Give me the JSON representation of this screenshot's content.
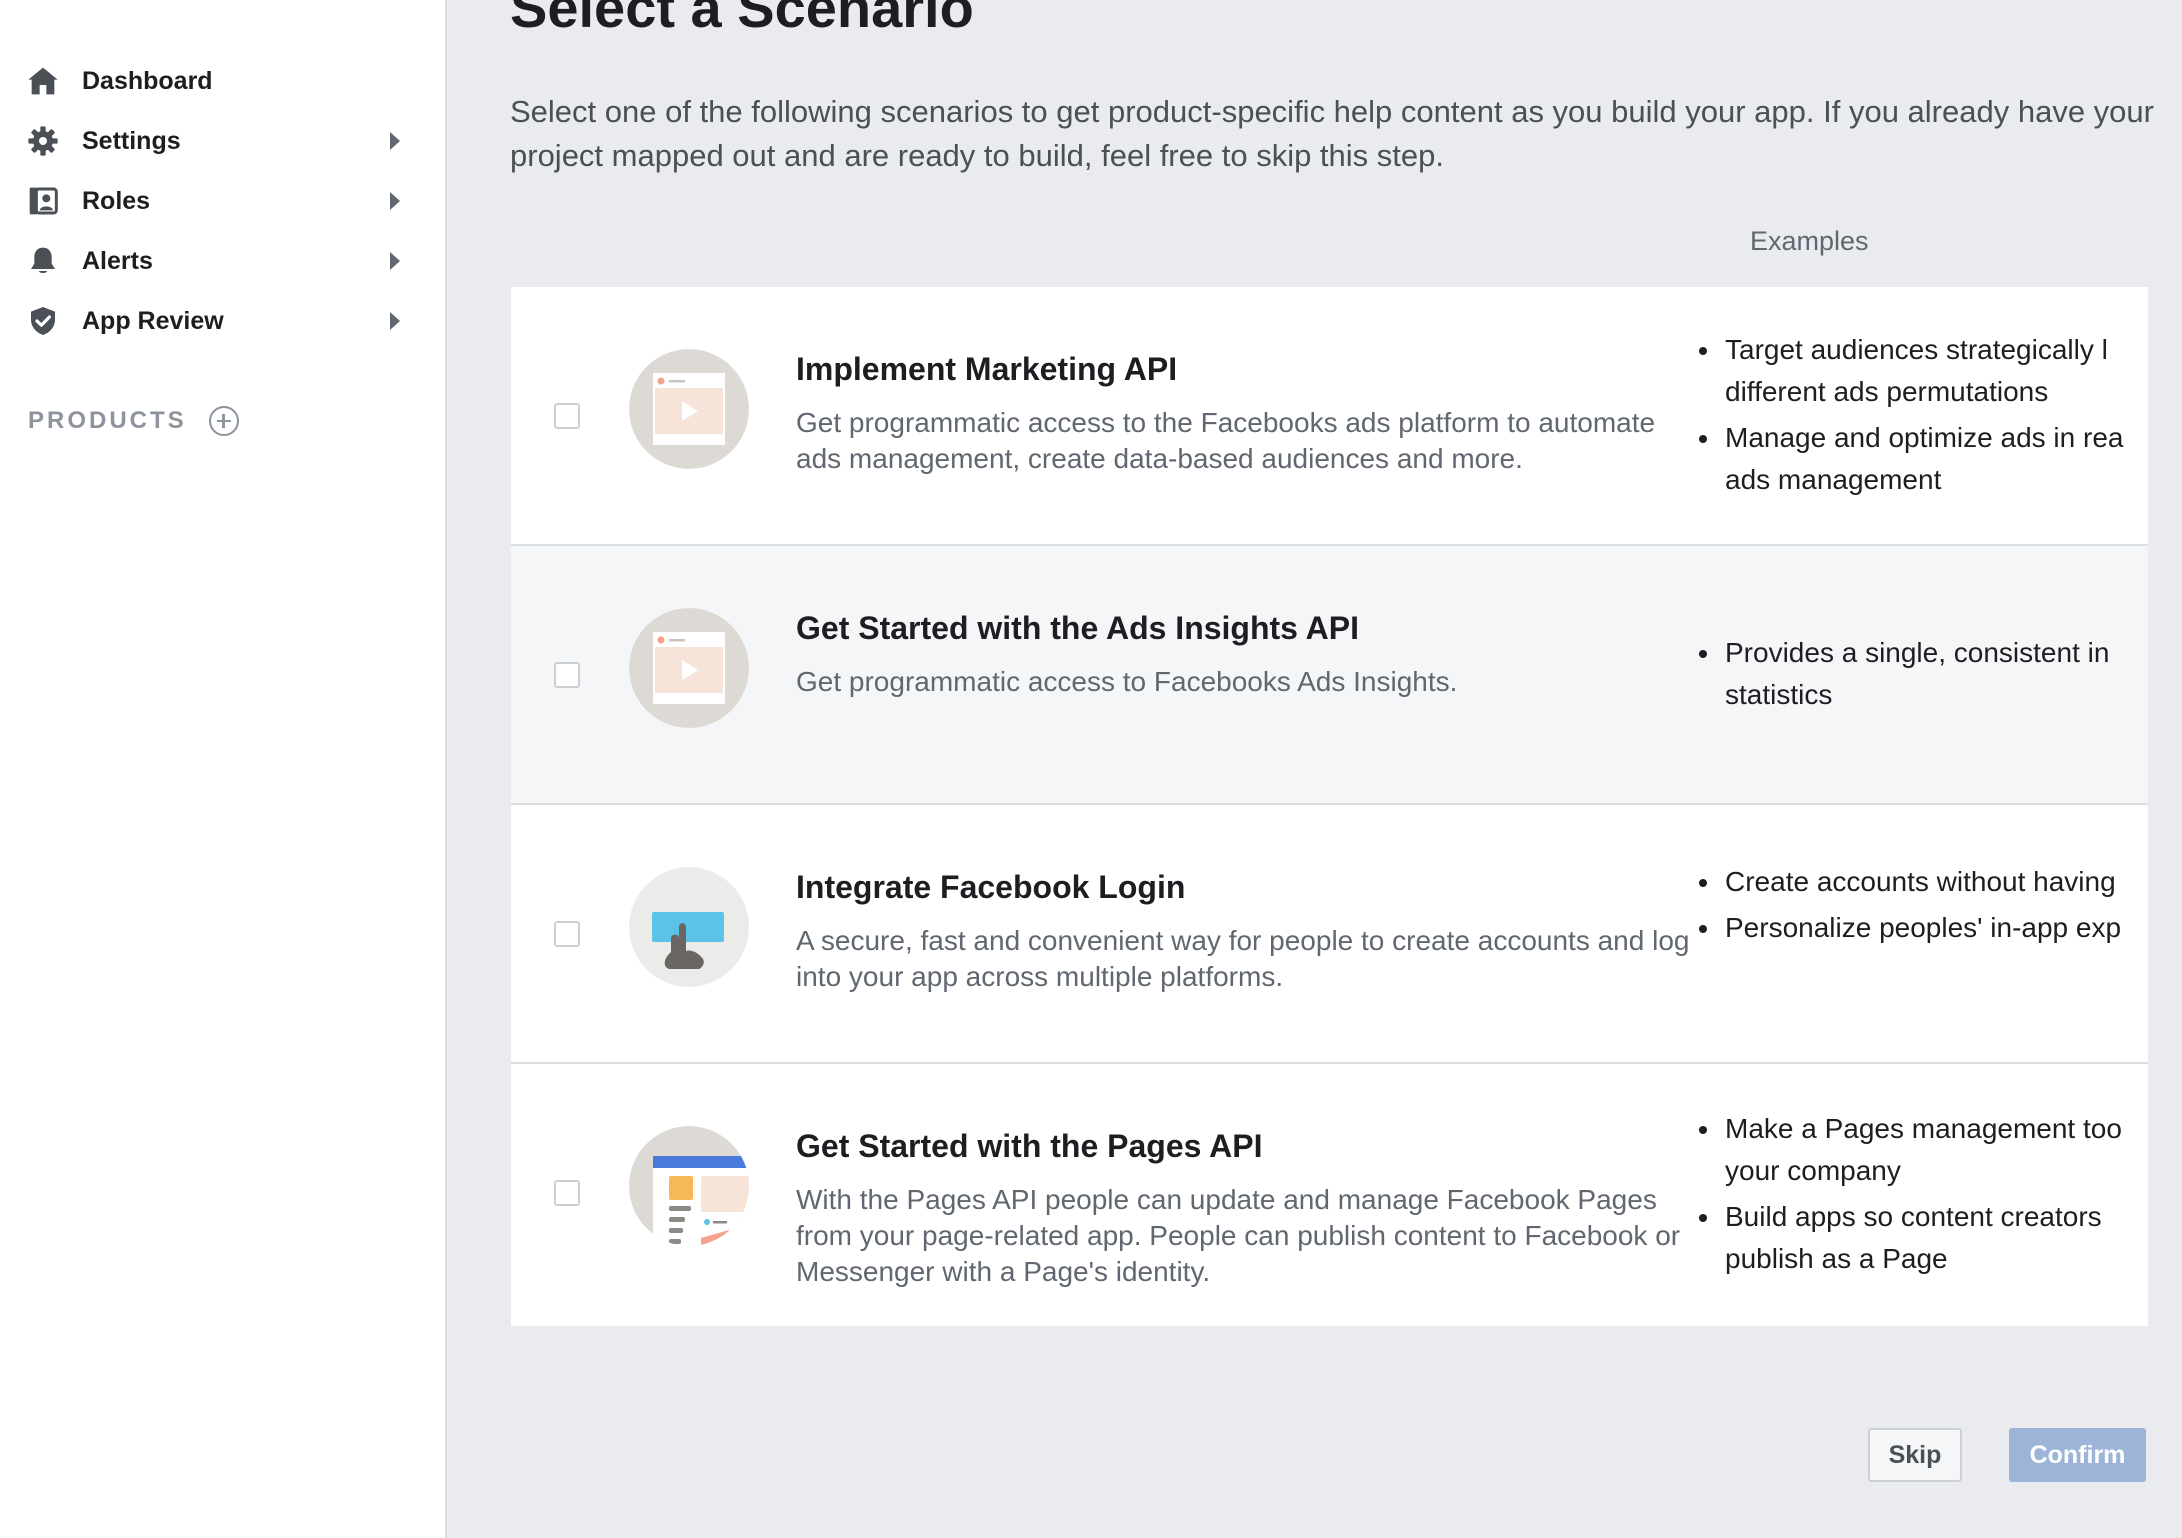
{
  "sidebar": {
    "items": [
      {
        "label": "Dashboard",
        "icon": "home-icon",
        "has_caret": false
      },
      {
        "label": "Settings",
        "icon": "gear-icon",
        "has_caret": true
      },
      {
        "label": "Roles",
        "icon": "roles-icon",
        "has_caret": true
      },
      {
        "label": "Alerts",
        "icon": "bell-icon",
        "has_caret": true
      },
      {
        "label": "App Review",
        "icon": "shield-check-icon",
        "has_caret": true
      }
    ],
    "products_label": "PRODUCTS"
  },
  "main": {
    "title": "Select a Scenario",
    "description": "Select one of the following scenarios to get product-specific help content as you build your app. If you already have your project mapped out and are ready to build, feel free to skip this step.",
    "examples_header": "Examples",
    "scenarios": [
      {
        "title": "Implement Marketing API",
        "description": "Get programmatic access to the Facebooks ads platform to automate ads management, create data-based audiences and more.",
        "checked": false,
        "illustration": "video-ad-illustration",
        "examples": [
          [
            "Target audiences strategically l",
            "different ads permutations"
          ],
          [
            "Manage and optimize ads in rea",
            "ads management"
          ]
        ]
      },
      {
        "title": "Get Started with the Ads Insights API",
        "description": "Get programmatic access to Facebooks Ads Insights.",
        "checked": false,
        "illustration": "video-ad-illustration",
        "examples": [
          [
            "Provides a single, consistent in",
            "statistics"
          ]
        ]
      },
      {
        "title": "Integrate Facebook Login",
        "description": "A secure, fast and convenient way for people to create accounts and log into your app across multiple platforms.",
        "checked": false,
        "illustration": "login-tap-illustration",
        "examples": [
          [
            "Create accounts without having"
          ],
          [
            "Personalize peoples' in-app exp"
          ]
        ]
      },
      {
        "title": "Get Started with the Pages API",
        "description": "With the Pages API people can update and manage Facebook Pages from your page-related app. People can publish content to Facebook or Messenger with a Page's identity.",
        "checked": false,
        "illustration": "pages-illustration",
        "examples": [
          [
            "Make a Pages management too",
            "your company"
          ],
          [
            "Build apps so content creators",
            "publish as a Page"
          ]
        ]
      }
    ],
    "buttons": {
      "skip": "Skip",
      "confirm": "Confirm"
    }
  },
  "colors": {
    "background": "#e9ebee",
    "confirm_disabled": "#9cb4d8",
    "text_primary": "#1c1e21",
    "text_secondary": "#606770"
  }
}
